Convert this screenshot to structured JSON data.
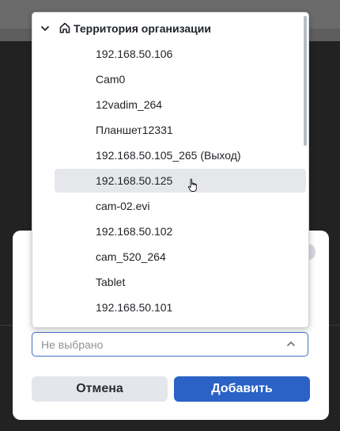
{
  "dropdown": {
    "group_label": "Территория организации",
    "hovered_index": 5,
    "items": [
      {
        "label": "192.168.50.106"
      },
      {
        "label": "Cam0"
      },
      {
        "label": "12vadim_264"
      },
      {
        "label": "Планшет12331"
      },
      {
        "label": "192.168.50.105_265 (Выход)"
      },
      {
        "label": "192.168.50.125"
      },
      {
        "label": "cam-02.evi"
      },
      {
        "label": "192.168.50.102"
      },
      {
        "label": "cam_520_264"
      },
      {
        "label": "Tablet"
      },
      {
        "label": "192.168.50.101"
      }
    ]
  },
  "select": {
    "placeholder": "Не выбрано"
  },
  "buttons": {
    "cancel_label": "Отмена",
    "add_label": "Добавить"
  },
  "colors": {
    "accent": "#2b62c6",
    "hover_bg": "#e5e7eb",
    "field_border": "#3f6fc4"
  },
  "icons": {
    "group_expand": "chevron-down-icon",
    "group_type": "home-icon",
    "select_toggle": "chevron-up-icon",
    "pointer": "hand-cursor-icon"
  }
}
